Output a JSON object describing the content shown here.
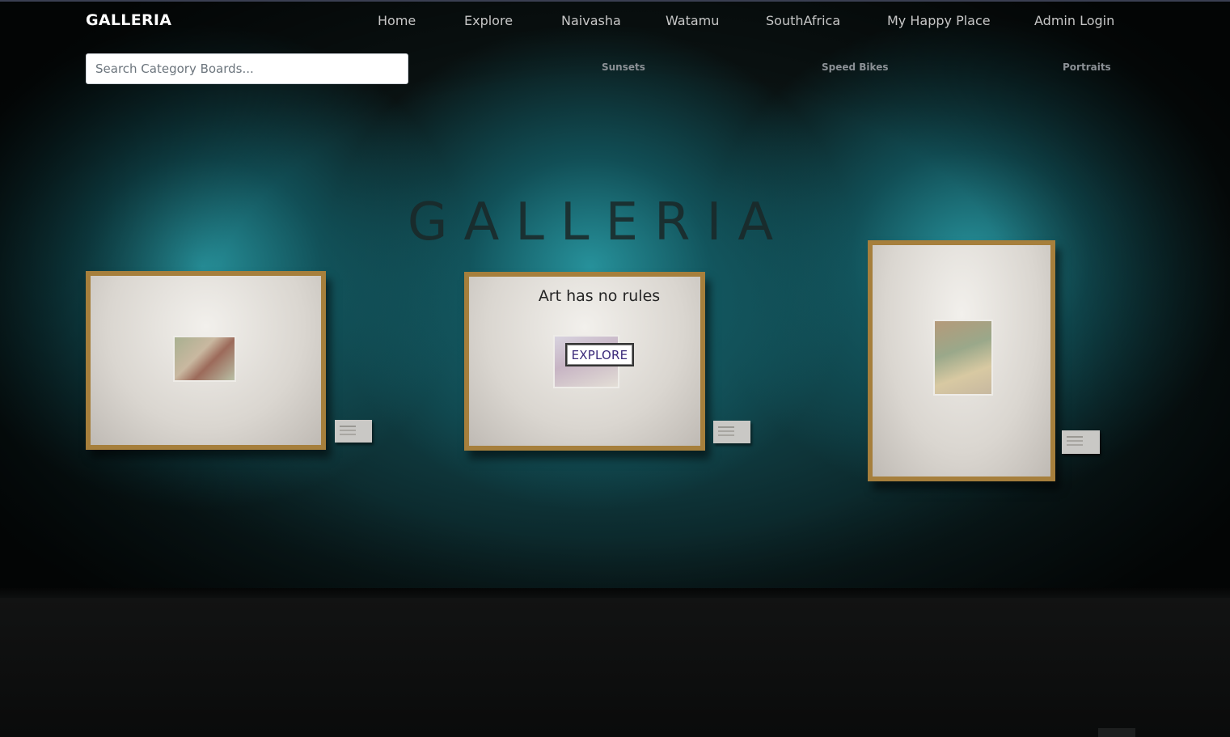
{
  "brand": "GALLERIA",
  "nav": {
    "items": [
      {
        "label": "Home"
      },
      {
        "label": "Explore"
      },
      {
        "label": "Naivasha"
      },
      {
        "label": "Watamu"
      },
      {
        "label": "SouthAfrica"
      },
      {
        "label": "My Happy Place"
      },
      {
        "label": "Admin Login"
      }
    ]
  },
  "search": {
    "placeholder": "Search Category Boards...",
    "value": ""
  },
  "categories": [
    {
      "label": "Sunsets"
    },
    {
      "label": "Speed Bikes"
    },
    {
      "label": "Portraits"
    }
  ],
  "hero": {
    "title": "GALLERIA",
    "tagline": "Art has no rules",
    "button_label": "EXPLORE"
  },
  "colors": {
    "wall_accent": "#1f8c96",
    "button_text": "#3b2a7a",
    "brand_text": "#ffffff"
  }
}
